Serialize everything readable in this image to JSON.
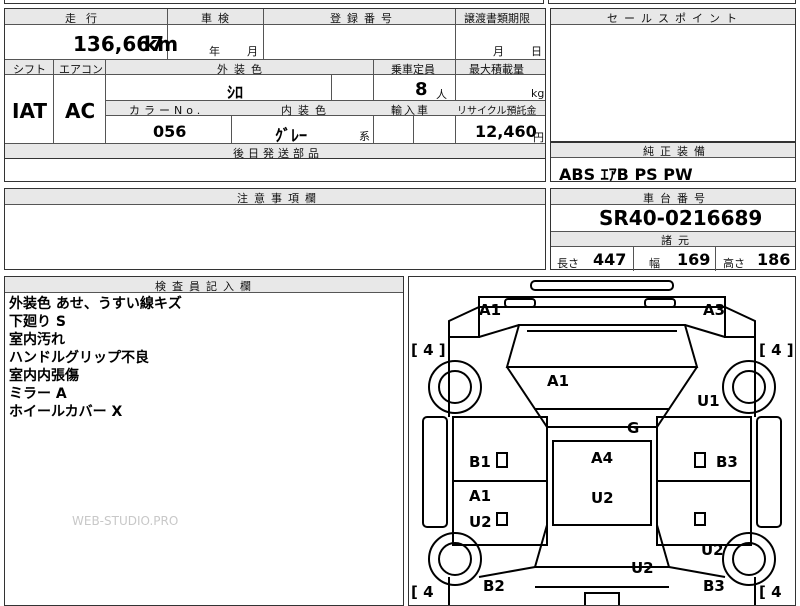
{
  "top_row": {
    "mileage_label": "走行",
    "mileage_value": "136,667",
    "mileage_unit": "km",
    "inspection_label": "車検",
    "inspection_year": "年",
    "inspection_month": "月",
    "reg_label": "登録番号",
    "transfer_label": "譲渡書類期限",
    "transfer_month": "月",
    "transfer_day": "日"
  },
  "row2": {
    "shift_label": "シフト",
    "shift_value": "IAT",
    "ac_label": "エアコン",
    "ac_value": "AC",
    "color_label": "外装色",
    "color_value": "ｼﾛ",
    "capacity_label": "乗車定員",
    "capacity_value": "8",
    "capacity_unit": "人",
    "load_label": "最大積載量",
    "load_unit": "kg",
    "color_no_label": "カラーNo.",
    "color_no_value": "056",
    "interior_label": "内装色",
    "interior_value": "ｸﾞﾚｰ",
    "interior_suffix": "系",
    "import_label": "輸入車",
    "recycle_label": "リサイクル預託金",
    "recycle_value": "12,460",
    "recycle_unit": "円",
    "later_parts_label": "後日発送部品"
  },
  "sales_point": {
    "label": "セールスポイント"
  },
  "equipment": {
    "label": "純正装備",
    "value": "ABS ｴｱB PS PW"
  },
  "caution": {
    "label": "注意事項欄"
  },
  "chassis": {
    "label": "車台番号",
    "value": "SR40-0216689"
  },
  "specs": {
    "label": "諸元",
    "length_label": "長さ",
    "length_value": "447",
    "width_label": "幅",
    "width_value": "169",
    "height_label": "高さ",
    "height_value": "186"
  },
  "inspector": {
    "label": "検査員記入欄",
    "notes": [
      "外装色 あせ、うすい線キズ",
      "下廻り S",
      "室内汚れ",
      "ハンドルグリップ不良",
      "室内内張傷",
      "ミラー A",
      "ホイールカバー X"
    ]
  },
  "watermark": "WEB-STUDIO.PRO",
  "diagram": {
    "marks": {
      "front_left": "A1",
      "front_right": "A3",
      "hood": "A1",
      "right_front": "U1",
      "roof_front": "G",
      "left_door1": "B1",
      "roof": "A4",
      "right_door1": "B3",
      "left_door2a": "A1",
      "roof_rear": "U2",
      "left_door2b": "U2",
      "right_rear": "U2",
      "tailgate": "U2",
      "rear_left": "B2",
      "rear_right": "B3"
    },
    "tire_fl": "[ 4 ]",
    "tire_fr": "[ 4 ]",
    "tire_rl": "[ 4",
    "tire_rr": "[ 4"
  }
}
